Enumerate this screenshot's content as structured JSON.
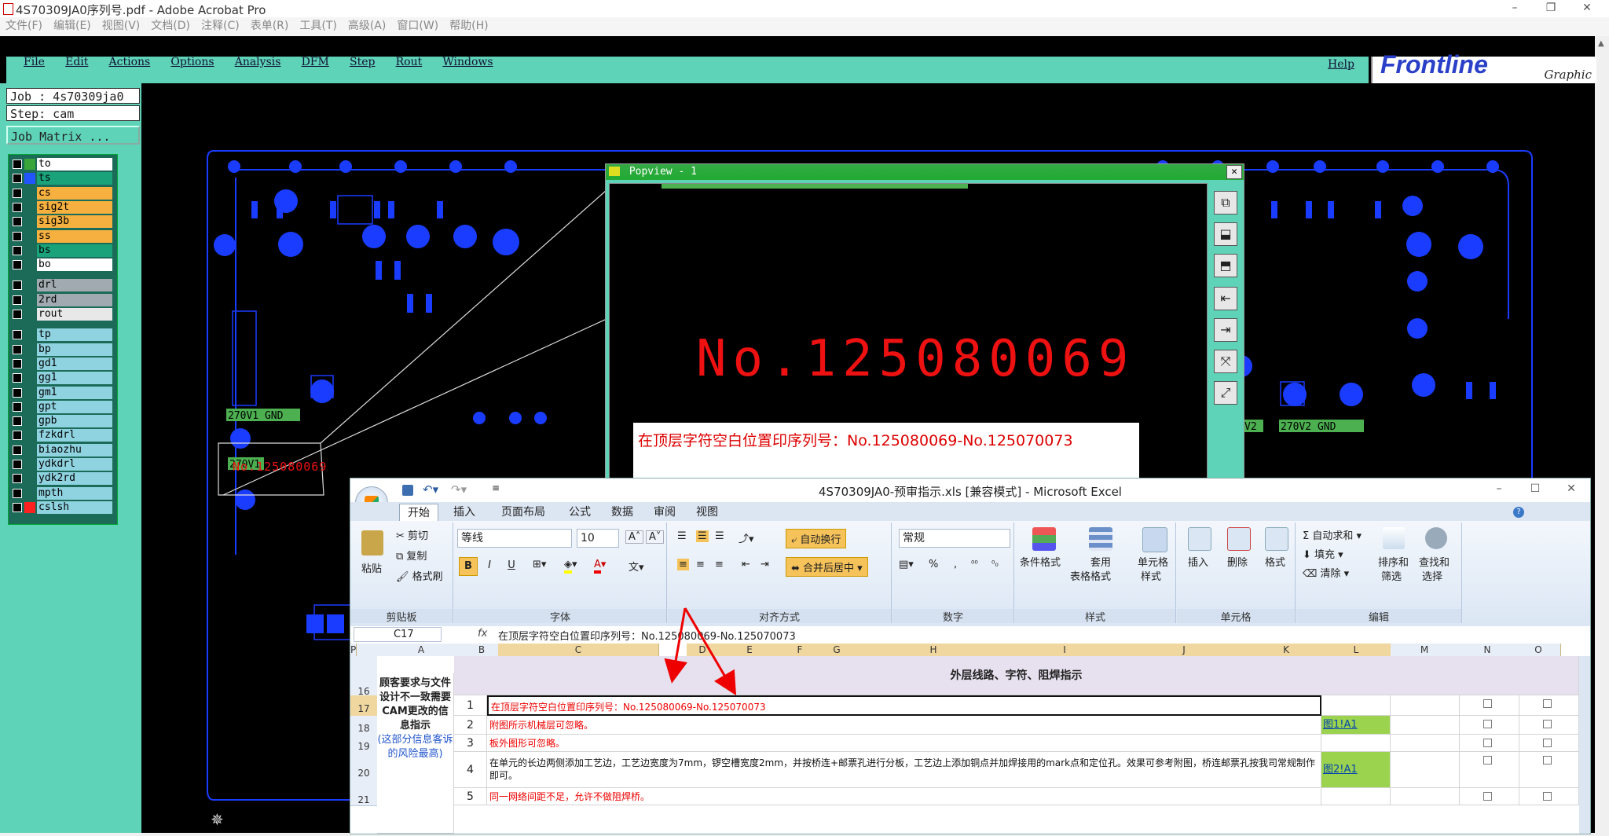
{
  "acrobat": {
    "title": "4S70309JA0序列号.pdf - Adobe Acrobat Pro",
    "menu": [
      "文件(F)",
      "编辑(E)",
      "视图(V)",
      "文档(D)",
      "注释(C)",
      "表单(R)",
      "工具(T)",
      "高级(A)",
      "窗口(W)",
      "帮助(H)"
    ]
  },
  "cam": {
    "menu": [
      "File",
      "Edit",
      "Actions",
      "Options",
      "Analysis",
      "DFM",
      "Step",
      "Rout",
      "Windows"
    ],
    "help": "Help",
    "logo": "Frontline",
    "logo_sub": "Graphic",
    "job": "Job : 4s70309ja0",
    "step": "Step: cam",
    "job_matrix": "Job Matrix ...",
    "layers": [
      {
        "name": "to",
        "color": "#ffffff",
        "swatch": "#3aa53a"
      },
      {
        "name": "ts",
        "color": "#1aa37a",
        "swatch": "#2255ff"
      },
      {
        "name": "cs",
        "color": "#f5b040",
        "swatch": ""
      },
      {
        "name": "sig2t",
        "color": "#f5b040",
        "swatch": ""
      },
      {
        "name": "sig3b",
        "color": "#f5b040",
        "swatch": ""
      },
      {
        "name": "ss",
        "color": "#f5b040",
        "swatch": ""
      },
      {
        "name": "bs",
        "color": "#1aa37a",
        "swatch": ""
      },
      {
        "name": "bo",
        "color": "#ffffff",
        "swatch": ""
      },
      {
        "name": "drl",
        "color": "#a0aab0",
        "swatch": ""
      },
      {
        "name": "2rd",
        "color": "#a0aab0",
        "swatch": ""
      },
      {
        "name": "rout",
        "color": "#e8e8e8",
        "swatch": ""
      },
      {
        "name": "tp",
        "color": "#8fd3e0",
        "swatch": ""
      },
      {
        "name": "bp",
        "color": "#8fd3e0",
        "swatch": ""
      },
      {
        "name": "gd1",
        "color": "#8fd3e0",
        "swatch": ""
      },
      {
        "name": "gg1",
        "color": "#8fd3e0",
        "swatch": ""
      },
      {
        "name": "gm1",
        "color": "#8fd3e0",
        "swatch": ""
      },
      {
        "name": "gpt",
        "color": "#8fd3e0",
        "swatch": ""
      },
      {
        "name": "gpb",
        "color": "#8fd3e0",
        "swatch": ""
      },
      {
        "name": "fzkdrl",
        "color": "#8fd3e0",
        "swatch": ""
      },
      {
        "name": "biaozhu",
        "color": "#8fd3e0",
        "swatch": ""
      },
      {
        "name": "ydkdrl",
        "color": "#8fd3e0",
        "swatch": ""
      },
      {
        "name": "ydk2rd",
        "color": "#8fd3e0",
        "swatch": ""
      },
      {
        "name": "mpth",
        "color": "#8fd3e0",
        "swatch": ""
      },
      {
        "name": "cslsh",
        "color": "#8fd3e0",
        "swatch": "#ff2020"
      }
    ],
    "board_labels": {
      "gnd1": "270V1 GND",
      "v1": "270V1",
      "gnd2": "270V2 GND",
      "v2": "V2",
      "serial_small": "No.125080069"
    }
  },
  "popview": {
    "title": "Popview - 1",
    "serial": "No.125080069",
    "note": "在顶层字符空白位置印序列号：No.125080069-No.125070073"
  },
  "excel": {
    "title": "4S70309JA0-预审指示.xls  [兼容模式] - Microsoft Excel",
    "tabs": [
      "开始",
      "插入",
      "页面布局",
      "公式",
      "数据",
      "审阅",
      "视图"
    ],
    "clipboard": {
      "paste": "粘贴",
      "cut": "剪切",
      "copy": "复制",
      "format_painter": "格式刷",
      "label": "剪贴板"
    },
    "font": {
      "name": "等线",
      "size": "10",
      "label": "字体",
      "bold": "B",
      "italic": "I",
      "underline": "U"
    },
    "alignment": {
      "wrap": "自动换行",
      "merge": "合并后居中",
      "label": "对齐方式"
    },
    "number": {
      "format": "常规",
      "percent": "%",
      "comma": ",",
      "label": "数字"
    },
    "styles": {
      "conditional": "条件格式",
      "table_a": "套用",
      "table_b": "表格格式",
      "cell_a": "单元格",
      "cell_b": "样式",
      "label": "样式"
    },
    "cells": {
      "insert": "插入",
      "delete": "删除",
      "format": "格式",
      "label": "单元格"
    },
    "editing": {
      "autosum": "自动求和",
      "fill": "填充",
      "clear": "清除",
      "sort_a": "排序和",
      "sort_b": "筛选",
      "find_a": "查找和",
      "find_b": "选择",
      "label": "编辑"
    },
    "name_box": "C17",
    "fx": "fx",
    "formula": "在顶层字符空白位置印序列号：No.125080069-No.125070073",
    "columns": [
      "A",
      "B",
      "C",
      "D",
      "E",
      "F",
      "G",
      "H",
      "I",
      "J",
      "K",
      "L",
      "M",
      "N",
      "O",
      "P"
    ],
    "header_row": "16",
    "header_text": "外层线路、字符、阻焊指示",
    "side_note_black": "顾客要求与文件设计不一致需要CAM更改的信息指示",
    "side_note_blue": "(这部分信息客诉的风险最高)",
    "rows": [
      {
        "row": "17",
        "num": "1",
        "text": "在顶层字符空白位置印序列号：No.125080069-No.125070073",
        "link": ""
      },
      {
        "row": "18",
        "num": "2",
        "text": "附图所示机械层可忽略。",
        "link": "图1!A1"
      },
      {
        "row": "19",
        "num": "3",
        "text": "板外图形可忽略。",
        "link": ""
      },
      {
        "row": "20",
        "num": "4",
        "text": "在单元的长边两侧添加工艺边，工艺边宽度为7mm，锣空槽宽度2mm，并按桥连+邮票孔进行分板，工艺边上添加铜点并加焊接用的mark点和定位孔。效果可参考附图，桥连邮票孔按我司常规制作即可。",
        "link": "图2!A1"
      },
      {
        "row": "21",
        "num": "5",
        "text": "同一网络间距不足，允许不做阻焊桥。",
        "link": ""
      }
    ]
  }
}
